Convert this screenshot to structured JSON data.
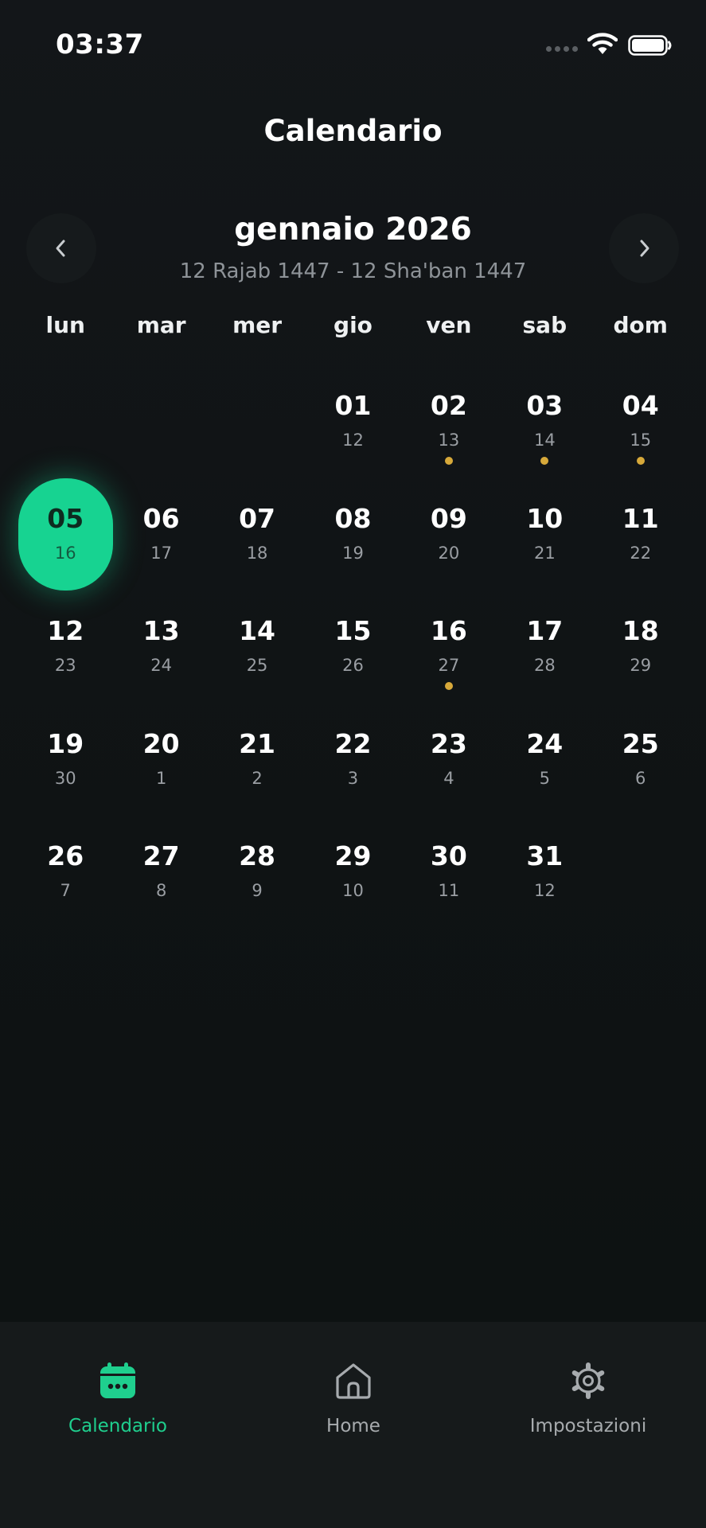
{
  "status_bar": {
    "time": "03:37"
  },
  "header": {
    "title": "Calendario"
  },
  "calendar": {
    "month_title": "gennaio 2026",
    "hijri_range": "12 Rajab 1447 - 12 Sha'ban 1447",
    "weekdays": [
      "lun",
      "mar",
      "mer",
      "gio",
      "ven",
      "sab",
      "dom"
    ],
    "selected_day": "05",
    "weeks": [
      [
        null,
        null,
        null,
        {
          "day": "01",
          "hijri": "12",
          "event": false
        },
        {
          "day": "02",
          "hijri": "13",
          "event": true
        },
        {
          "day": "03",
          "hijri": "14",
          "event": true
        },
        {
          "day": "04",
          "hijri": "15",
          "event": true
        }
      ],
      [
        {
          "day": "05",
          "hijri": "16",
          "event": false
        },
        {
          "day": "06",
          "hijri": "17",
          "event": false
        },
        {
          "day": "07",
          "hijri": "18",
          "event": false
        },
        {
          "day": "08",
          "hijri": "19",
          "event": false
        },
        {
          "day": "09",
          "hijri": "20",
          "event": false
        },
        {
          "day": "10",
          "hijri": "21",
          "event": false
        },
        {
          "day": "11",
          "hijri": "22",
          "event": false
        }
      ],
      [
        {
          "day": "12",
          "hijri": "23",
          "event": false
        },
        {
          "day": "13",
          "hijri": "24",
          "event": false
        },
        {
          "day": "14",
          "hijri": "25",
          "event": false
        },
        {
          "day": "15",
          "hijri": "26",
          "event": false
        },
        {
          "day": "16",
          "hijri": "27",
          "event": true
        },
        {
          "day": "17",
          "hijri": "28",
          "event": false
        },
        {
          "day": "18",
          "hijri": "29",
          "event": false
        }
      ],
      [
        {
          "day": "19",
          "hijri": "30",
          "event": false
        },
        {
          "day": "20",
          "hijri": "1",
          "event": false
        },
        {
          "day": "21",
          "hijri": "2",
          "event": false
        },
        {
          "day": "22",
          "hijri": "3",
          "event": false
        },
        {
          "day": "23",
          "hijri": "4",
          "event": false
        },
        {
          "day": "24",
          "hijri": "5",
          "event": false
        },
        {
          "day": "25",
          "hijri": "6",
          "event": false
        }
      ],
      [
        {
          "day": "26",
          "hijri": "7",
          "event": false
        },
        {
          "day": "27",
          "hijri": "8",
          "event": false
        },
        {
          "day": "28",
          "hijri": "9",
          "event": false
        },
        {
          "day": "29",
          "hijri": "10",
          "event": false
        },
        {
          "day": "30",
          "hijri": "11",
          "event": false
        },
        {
          "day": "31",
          "hijri": "12",
          "event": false
        },
        null
      ]
    ]
  },
  "tab_bar": {
    "tabs": [
      {
        "label": "Calendario",
        "icon": "calendar-icon",
        "active": true
      },
      {
        "label": "Home",
        "icon": "home-icon",
        "active": false
      },
      {
        "label": "Impostazioni",
        "icon": "gear-icon",
        "active": false
      }
    ]
  },
  "colors": {
    "accent": "#17d391",
    "event_dot": "#d7a93a",
    "background": "#111517",
    "tab_bar": "#161a1b"
  }
}
